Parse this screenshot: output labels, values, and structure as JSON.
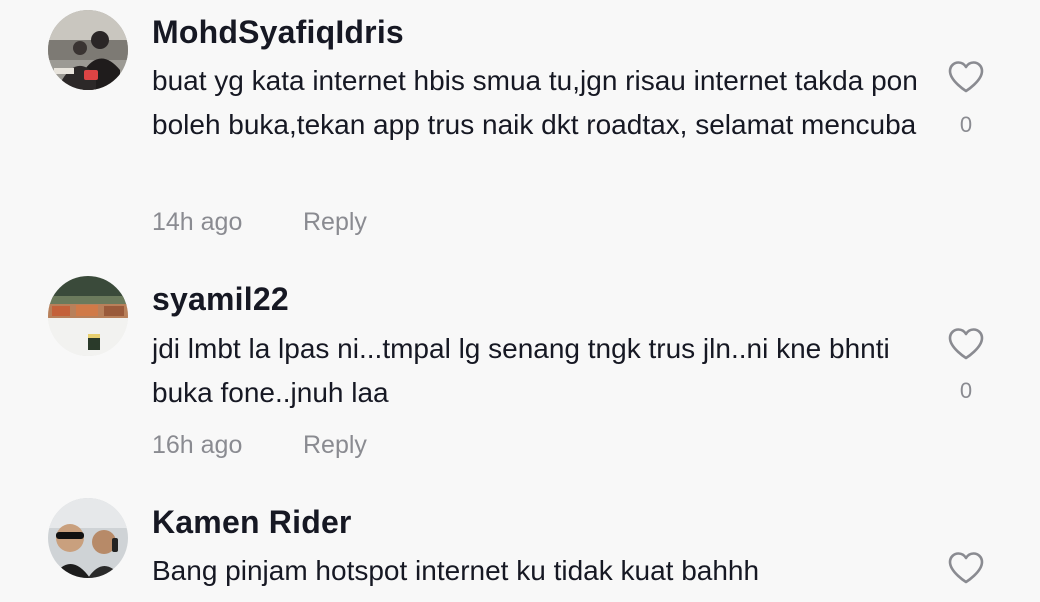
{
  "comments": [
    {
      "username": "MohdSyafiqIdris",
      "text": "buat yg kata internet hbis smua tu,jgn risau internet takda pon boleh buka,tekan app trus naik dkt roadtax, selamat mencuba",
      "time": "14h ago",
      "reply_label": "Reply",
      "likes": "0"
    },
    {
      "username": "syamil22",
      "text": "jdi lmbt la lpas ni...tmpal lg senang tngk trus jln..ni kne bhnti buka fone..jnuh laa",
      "time": "16h ago",
      "reply_label": "Reply",
      "likes": "0"
    },
    {
      "username": "Kamen Rider",
      "text": "Bang pinjam hotspot internet ku tidak kuat bahhh"
    }
  ],
  "colors": {
    "text": "#161823",
    "secondary": "#8a8b91",
    "background": "#f8f8f8"
  },
  "icons": {
    "like": "heart-outline-icon"
  }
}
